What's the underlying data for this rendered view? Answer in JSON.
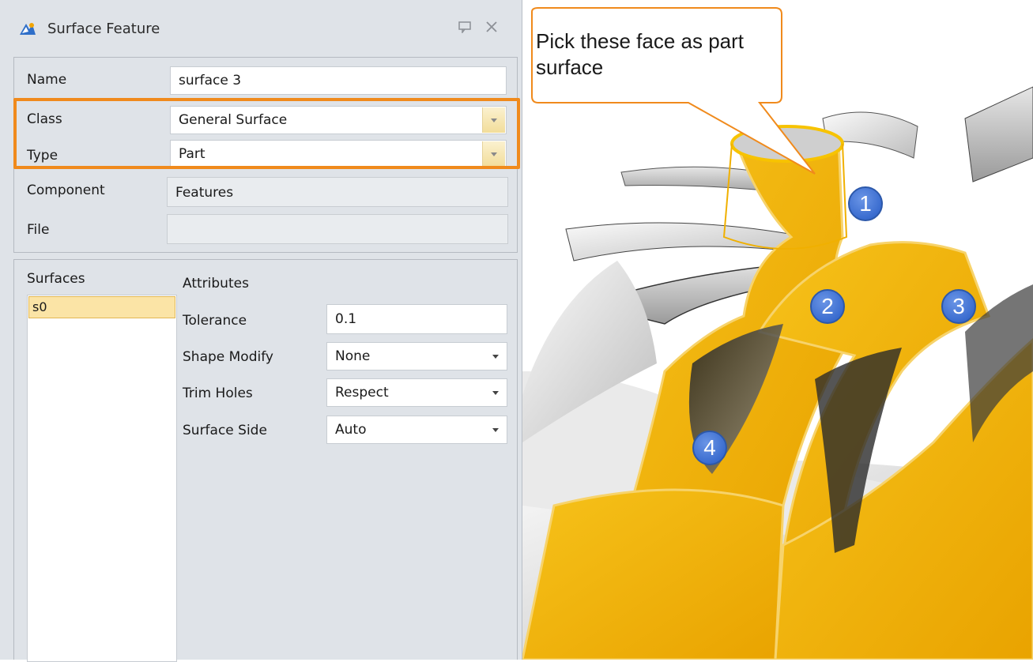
{
  "dialog": {
    "title": "Surface Feature",
    "icons": {
      "app": "surface-feature-icon",
      "pin": "pin-icon",
      "close": "close-icon"
    }
  },
  "properties": {
    "name_label": "Name",
    "name_value": "surface 3",
    "class_label": "Class",
    "class_value": "General Surface",
    "type_label": "Type",
    "type_value": "Part",
    "component_label": "Component",
    "component_value": "Features",
    "file_label": "File",
    "file_value": ""
  },
  "surfaces": {
    "header": "Surfaces",
    "items": [
      "s0"
    ]
  },
  "attributes": {
    "header": "Attributes",
    "tolerance_label": "Tolerance",
    "tolerance_value": "0.1",
    "shape_modify_label": "Shape Modify",
    "shape_modify_value": "None",
    "trim_holes_label": "Trim Holes",
    "trim_holes_value": "Respect",
    "surface_side_label": "Surface Side",
    "surface_side_value": "Auto"
  },
  "annotation": {
    "callout": "Pick these face as part surface",
    "badges": [
      "1",
      "2",
      "3",
      "4"
    ],
    "highlight_color": "#f08a1c"
  },
  "colors": {
    "selection_fill": "#f2b400",
    "panel_bg": "#dfe3e8",
    "badge_blue": "#3a6ccf"
  }
}
